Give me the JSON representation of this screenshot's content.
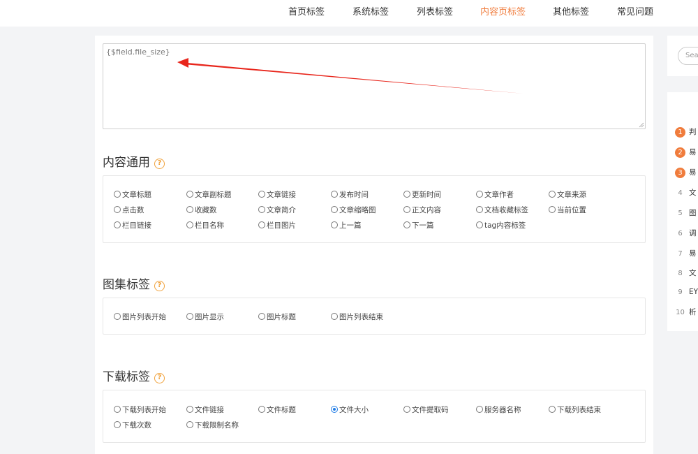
{
  "nav": {
    "items": [
      {
        "label": "首页标签"
      },
      {
        "label": "系统标签"
      },
      {
        "label": "列表标签"
      },
      {
        "label": "内容页标签"
      },
      {
        "label": "其他标签"
      },
      {
        "label": "常见问题"
      }
    ],
    "active_index": 3,
    "accent_color": "#f07c3c"
  },
  "code_box": {
    "value": "{$field.file_size}"
  },
  "sections": {
    "content": {
      "title": "内容通用",
      "options": [
        "文章标题",
        "文章副标题",
        "文章链接",
        "发布时间",
        "更新时间",
        "文章作者",
        "文章来源",
        "点击数",
        "收藏数",
        "文章简介",
        "文章缩略图",
        "正文内容",
        "文档收藏标签",
        "当前位置",
        "栏目链接",
        "栏目名称",
        "栏目图片",
        "上一篇",
        "下一篇",
        "tag内容标签"
      ]
    },
    "gallery": {
      "title": "图集标签",
      "options": [
        "图片列表开始",
        "图片显示",
        "图片标题",
        "图片列表结束"
      ]
    },
    "download": {
      "title": "下载标签",
      "options": [
        "下载列表开始",
        "文件链接",
        "文件标题",
        "文件大小",
        "文件提取码",
        "服务器名称",
        "下载列表结束",
        "下载次数",
        "下载限制名称"
      ],
      "selected": "文件大小"
    }
  },
  "sidebar": {
    "search_placeholder": "Sea",
    "ranks": [
      {
        "num": "1",
        "text": "判"
      },
      {
        "num": "2",
        "text": "易"
      },
      {
        "num": "3",
        "text": "易"
      },
      {
        "num": "4",
        "text": "文"
      },
      {
        "num": "5",
        "text": "图"
      },
      {
        "num": "6",
        "text": "调"
      },
      {
        "num": "7",
        "text": "易"
      },
      {
        "num": "8",
        "text": "文"
      },
      {
        "num": "9",
        "text": "EY"
      },
      {
        "num": "10",
        "text": "析"
      }
    ]
  },
  "icons": {
    "help": "help-circle-icon",
    "annotation_arrow_color": "#e8261c"
  }
}
